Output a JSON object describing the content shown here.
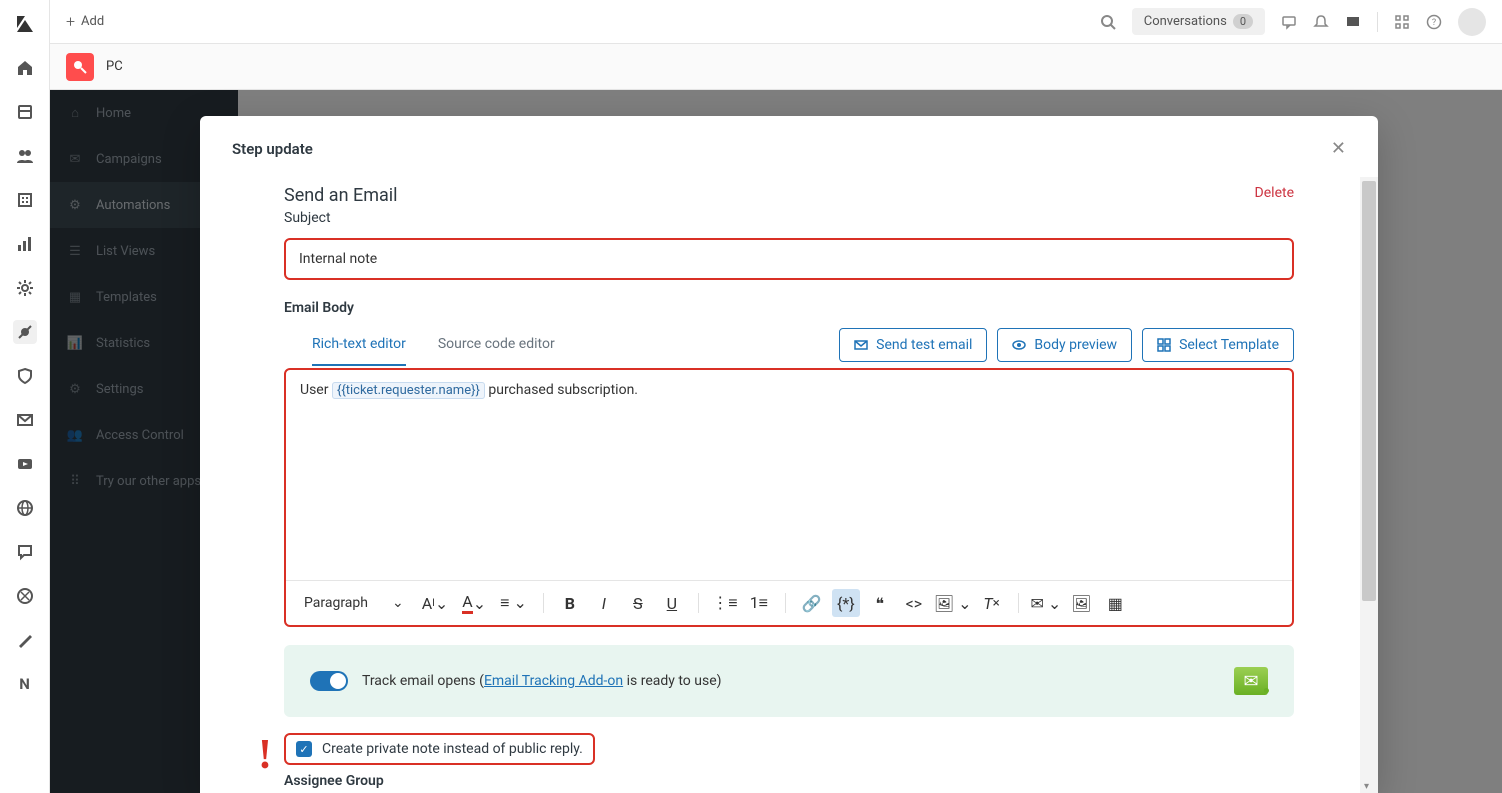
{
  "topbar": {
    "add_label": "Add",
    "conversations_label": "Conversations",
    "conversations_count": "0"
  },
  "subbar": {
    "app_label": "PC"
  },
  "sidemenu": {
    "items": [
      {
        "label": "Home"
      },
      {
        "label": "Campaigns"
      },
      {
        "label": "Automations"
      },
      {
        "label": "List Views"
      },
      {
        "label": "Templates"
      },
      {
        "label": "Statistics"
      },
      {
        "label": "Settings"
      },
      {
        "label": "Access Control"
      },
      {
        "label": "Try our other apps"
      }
    ]
  },
  "modal": {
    "title": "Step update",
    "section_title": "Send an Email",
    "delete_label": "Delete",
    "subject_label": "Subject",
    "subject_value": "Internal note",
    "body_label": "Email Body",
    "tabs": {
      "rich": "Rich-text editor",
      "source": "Source code editor"
    },
    "buttons": {
      "send_test": "Send test email",
      "preview": "Body preview",
      "select_template": "Select Template"
    },
    "editor": {
      "prefix": "User ",
      "variable": "{{ticket.requester.name}}",
      "suffix": "  purchased subscription.",
      "paragraph_label": "Paragraph"
    },
    "track": {
      "label": "Track email opens",
      "open": "(",
      "link": "Email Tracking Add-on",
      "rest": " is ready to use)",
      "close": ""
    },
    "private_note_label": "Create private note instead of public reply.",
    "assignee_label": "Assignee Group"
  }
}
